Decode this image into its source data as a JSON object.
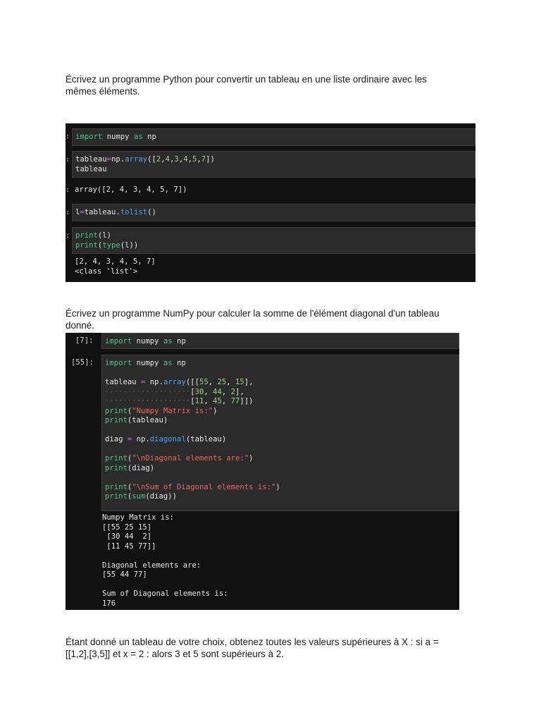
{
  "paragraphs": {
    "p1_line1": "Écrivez un programme Python pour convertir un tableau en une liste ordinaire avec les",
    "p1_line2": "mêmes éléments.",
    "p2_line1": "Écrivez un programme NumPy pour calculer la somme de l'élément diagonal d'un tableau",
    "p2_line2": "donné.",
    "p3_line1": "Étant donné un tableau de votre choix, obtenez toutes les valeurs supérieures à X : si a =",
    "p3_line2": "[[1,2],[3,5]] et x = 2 : alors 3 et 5 sont supérieurs à 2."
  },
  "notebook1": {
    "cell1": {
      "t1": "import",
      "t2": " numpy ",
      "t3": "as",
      "t4": " np"
    },
    "cell2": {
      "l1a": "tableau",
      "l1b": "=",
      "l1c": "np.",
      "l1d": "array",
      "l1e": "([",
      "n1": "2",
      "n2": "4",
      "n3": "3",
      "n4": "4",
      "n5": "5",
      "n6": "7",
      "l1f": "])",
      "l2": "tableau"
    },
    "out2": "array([2, 4, 3, 4, 5, 7])",
    "cell3": {
      "a": "l",
      "b": "=",
      "c": "tableau.",
      "d": "tolist",
      "e": "()"
    },
    "cell4": {
      "l1a": "print",
      "l1b": "(l)",
      "l2a": "print",
      "l2b": "(",
      "l2c": "type",
      "l2d": "(l))"
    },
    "out4": "[2, 4, 3, 4, 5, 7]\n<class 'list'>"
  },
  "notebook2": {
    "prompt1": "[7]:",
    "prompt2": "[55]:",
    "cell1": {
      "t1": "import",
      "t2": " numpy ",
      "t3": "as",
      "t4": " np"
    },
    "cell2": {
      "imp1": "import",
      "imp2": " numpy ",
      "imp3": "as",
      "imp4": " np",
      "tab1": "tableau ",
      "tab2": "=",
      "tab3": " np.",
      "tab4": "array",
      "tab5": "([[",
      "a1": "55",
      "a2": "25",
      "a3": "15",
      "tab6": "],",
      "b1": "30",
      "b2": "44",
      "b3": "2",
      "tab7": "],",
      "c1": "11",
      "c2": "45",
      "c3": "77",
      "tab8": "]])",
      "pr1a": "print",
      "pr1b": "(",
      "pr1c": "\"Numpy Matrix is:\"",
      "pr1d": ")",
      "pr2a": "print",
      "pr2b": "(tableau)",
      "dg1": "diag ",
      "dg2": "=",
      "dg3": " np.",
      "dg4": "diagonal",
      "dg5": "(tableau)",
      "pr3a": "print",
      "pr3b": "(",
      "pr3c": "\"\\nDiagonal elements are:\"",
      "pr3d": ")",
      "pr4a": "print",
      "pr4b": "(diag)",
      "pr5a": "print",
      "pr5b": "(",
      "pr5c": "\"\\nSum of Diagonal elements is:\"",
      "pr5d": ")",
      "pr6a": "print",
      "pr6b": "(",
      "pr6c": "sum",
      "pr6d": "(diag))"
    },
    "output": "Numpy Matrix is:\n[[55 25 15]\n [30 44  2]\n [11 45 77]]\n\nDiagonal elements are:\n[55 44 77]\n\nSum of Diagonal elements is:\n176"
  }
}
